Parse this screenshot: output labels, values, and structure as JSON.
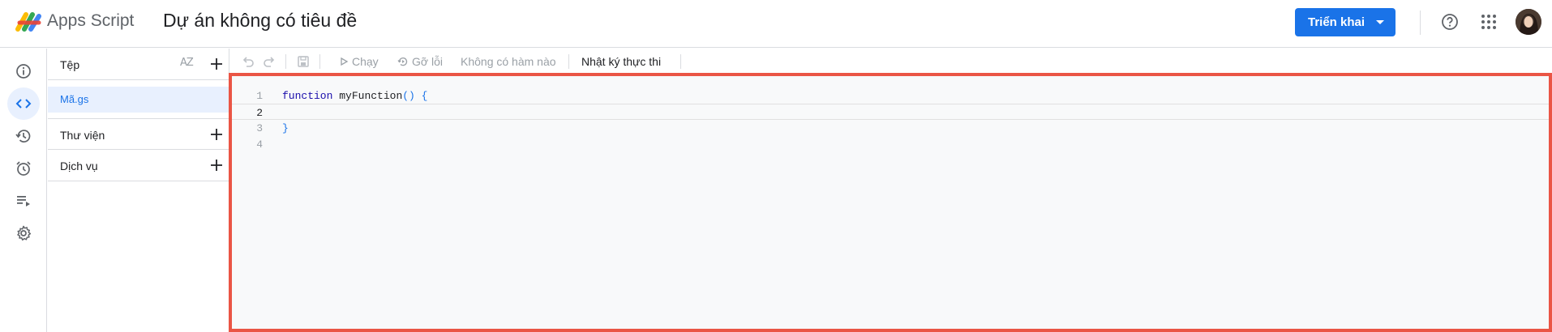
{
  "header": {
    "app_name": "Apps Script",
    "project_title": "Dự án không có tiêu đề",
    "deploy_label": "Triển khai"
  },
  "files_panel": {
    "files_title": "Tệp",
    "sort_label": "AZ",
    "files": [
      {
        "name": "Mã.gs",
        "selected": true
      }
    ],
    "libraries_title": "Thư viện",
    "services_title": "Dịch vụ"
  },
  "toolbar": {
    "run_label": "Chạy",
    "debug_label": "Gỡ lỗi",
    "function_select": "Không có hàm nào",
    "execution_log_label": "Nhật ký thực thi"
  },
  "editor": {
    "lines": [
      {
        "number": "1",
        "text": "function myFunction() {"
      },
      {
        "number": "2",
        "text": ""
      },
      {
        "number": "3",
        "text": "}"
      },
      {
        "number": "4",
        "text": ""
      }
    ],
    "current_line": 2
  },
  "colors": {
    "accent": "#1a73e8",
    "highlight_border": "#ea5545",
    "selected_bg": "#e8f0fe"
  }
}
